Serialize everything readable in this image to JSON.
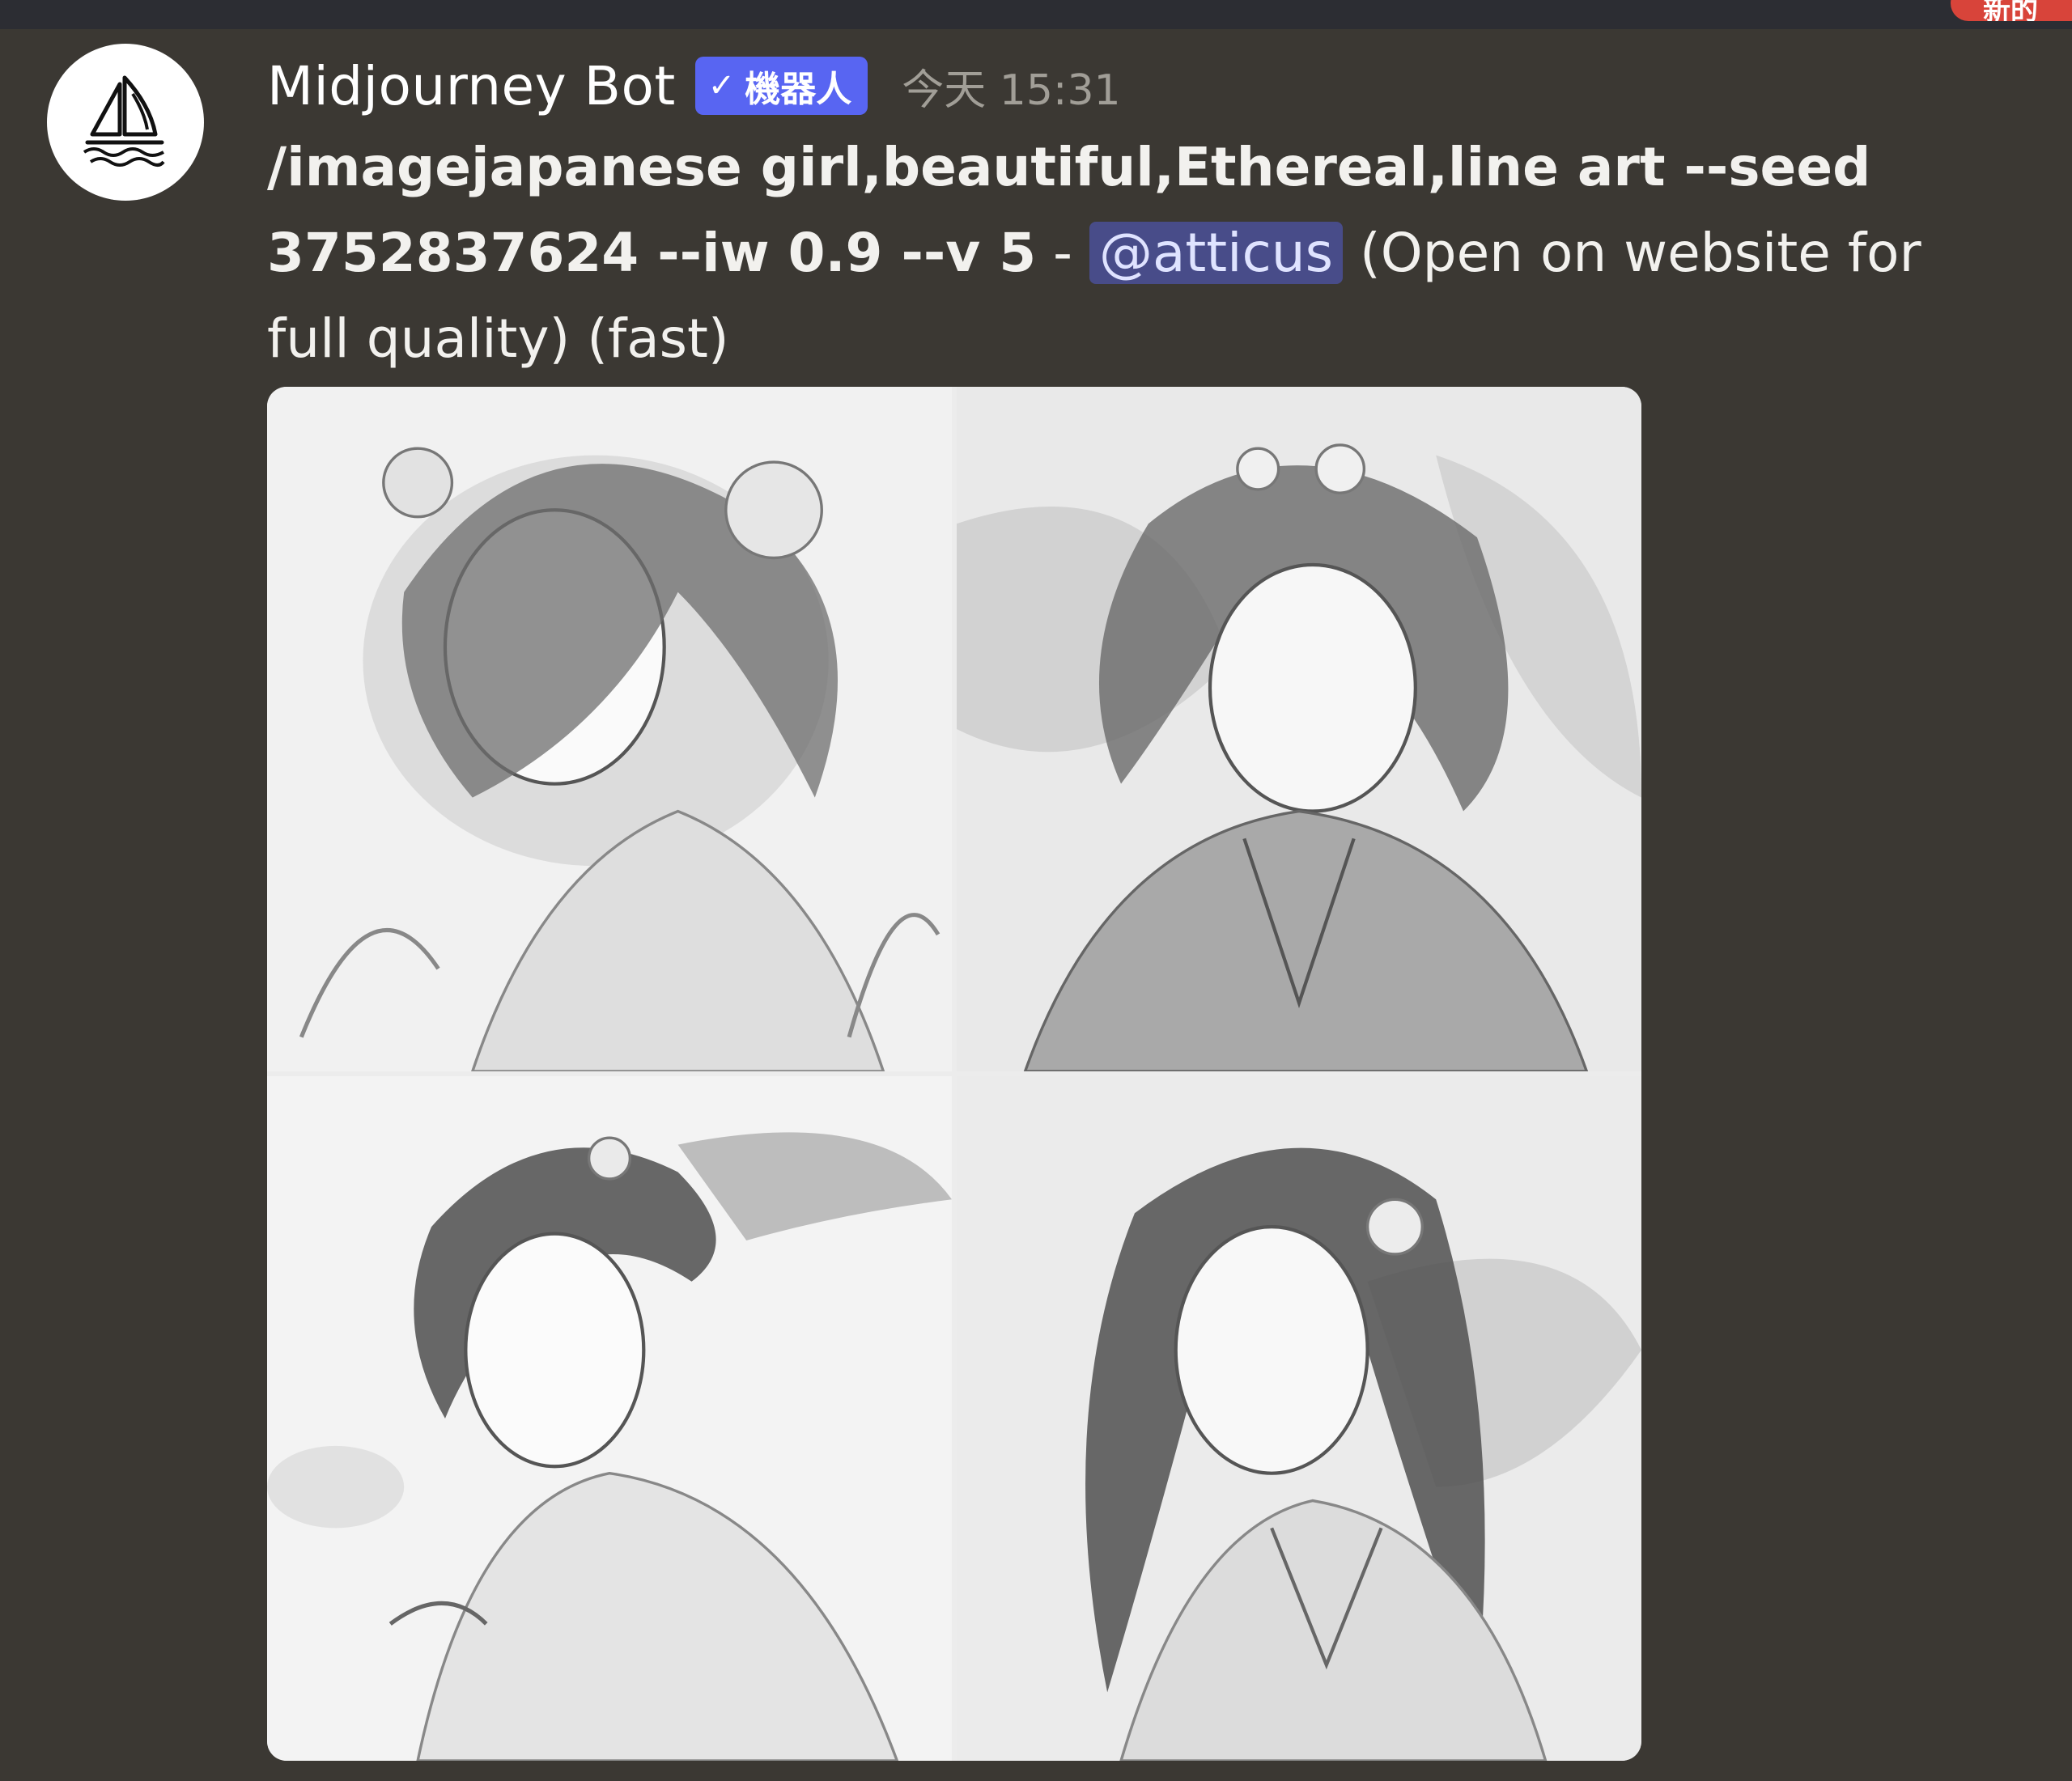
{
  "top_bar": {
    "new_badge_label": "新的",
    "badge_color": "#d8443a"
  },
  "message": {
    "avatar_icon": "sailboat-icon",
    "username": "Midjourney Bot",
    "bot_badge": {
      "check_icon": "✓",
      "label": "機器人",
      "color": "#5865f2"
    },
    "timestamp": "今天 15:31",
    "prompt_text": "/imagejapanese girl,beautiful,Ethereal,line art --seed 3752837624 --iw 0.9 --v 5",
    "separator": " - ",
    "mention": "@atticus",
    "suffix": " (Open on website for full quality) (fast)",
    "images": [
      {
        "name": "grid-image-1"
      },
      {
        "name": "grid-image-2"
      },
      {
        "name": "grid-image-3"
      },
      {
        "name": "grid-image-4"
      }
    ]
  }
}
